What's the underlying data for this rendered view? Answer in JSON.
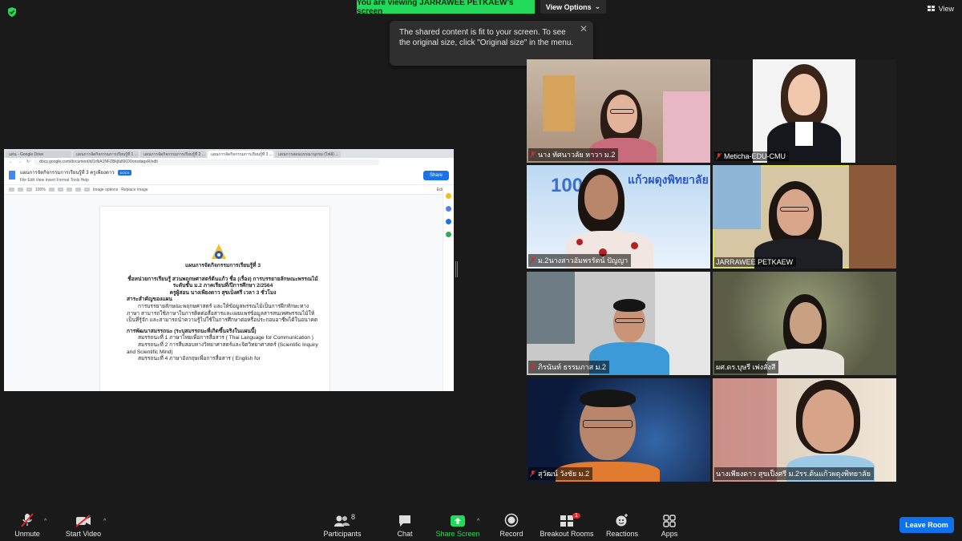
{
  "top": {
    "banner": "You are viewing JARRAWEE PETKAEW's screen",
    "view_options": "View Options",
    "view": "View"
  },
  "tooltip": {
    "text": "The shared content is fit to your screen. To see the original size, click \"Original size\" in the menu."
  },
  "shared": {
    "tabs": [
      "แผ่น - Google Drive",
      "แผนการจัดกิจกรรมการเรียนรู้ที่ 1 ...",
      "แผนการจัดกิจกรรมการเรียนรู้ที่ 2 ...",
      "แผนการจัดกิจกรรมการเรียนรู้ที่ 3 ...",
      "แผนการสอนบรรณานุกรม (ไฟล์) ..."
    ],
    "url": "docs.google.com/document/d/1rfkA1NFZBkjfal6KD0onsdaqxR/edit",
    "doc_title": "แผนการจัดกิจกรรมการเรียนรู้ที่ 3 ครูเพียงดาว",
    "doc_badge": "DOCX",
    "doc_menu": "File   Edit   View   Insert   Format   Tools   Help",
    "share": "Share",
    "toolbar_zoom": "100%",
    "toolbar_image_options": "Image options",
    "toolbar_replace_image": "Replace image",
    "toolbar_mode": "Editing",
    "lines": [
      "แผนการจัดกิจกรรมการเรียนรู้ที่ 3",
      "ชื่อหน่วยการเรียนรู้ สวนพฤกษศาสตร์ต้นแก้ว ชื่อ (เรื่อง) การบรรยายลักษณะพรรณไม้",
      "ระดับชั้น ม.2 ภาคเรียนที่/ปีการศึกษา 2/2564",
      "ครูผู้สอน นางเพียงดาว สุขเป็งศรี เวลา 3 ชั่วโมง",
      "สาระสำคัญของแผน",
      "การบรรยายลักษณะพฤกษศาสตร์ และให้ข้อมูลพรรณไม้เป็นการฝึกทักษะทางภาษา สามารถใช้ภาษาในการติดต่อสื่อสารและเผยแพร่ข้อมูลสารสนเทศพรรณไม้ให้เป็นที่รู้จัก และสามารถนำความรู้ไปใช้ในการศึกษาต่อหรือประกอบอาชีพได้ในอนาคต",
      "การพัฒนาสมรรถนะ (ระบุสมรรถนะที่เกิดขึ้นจริงในแผนนี้)",
      "สมรรถนะที่ 1 ภาษาไทยเพื่อการสื่อสาร ( Thai Language for Communication )",
      "สมรรถนะที่ 2 การสืบสอบทางวิทยาศาสตร์และจิตวิทยาศาสตร์ (Scientific Inquiry and Scientific Mind)",
      "สมรรถนะที่ 4 ภาษาอังกฤษเพื่อการสื่อสาร ( English for"
    ]
  },
  "participants": [
    {
      "name": "นาง ทัศนาวลัย หาวา ม.2",
      "muted": true
    },
    {
      "name": "Meticha-EDU-CMU",
      "muted": true
    },
    {
      "name": "ม.2นางสาวอัมพรรัตน์ ปัญญา",
      "muted": true
    },
    {
      "name": "JARRAWEE PETKAEW",
      "muted": false
    },
    {
      "name": "ภิรนันท์ ธรรมภาส ม.2",
      "muted": true
    },
    {
      "name": "ผศ.ดร.บุษรี เพ่งสั่งสี",
      "muted": false
    },
    {
      "name": "สุวัฒน์ วังชัย ม.2",
      "muted": true
    },
    {
      "name": "นางเพียงดาว สุขเป็งศรี ม.2รร.ต้นแก้วผดุงพิทยาลัย",
      "muted": false
    }
  ],
  "tile_logo_text": "แก้วผดุงพิทยาลัย",
  "toolbar": {
    "unmute": "Unmute",
    "start_video": "Start Video",
    "participants": "Participants",
    "participants_count": "8",
    "chat": "Chat",
    "share_screen": "Share Screen",
    "record": "Record",
    "breakout_rooms": "Breakout Rooms",
    "breakout_badge": "1",
    "reactions": "Reactions",
    "apps": "Apps",
    "leave": "Leave Room"
  },
  "colors": {
    "banner_green": "#23d959",
    "speaker_outline": "#d7e34c",
    "leave_blue": "#0e72ed"
  }
}
